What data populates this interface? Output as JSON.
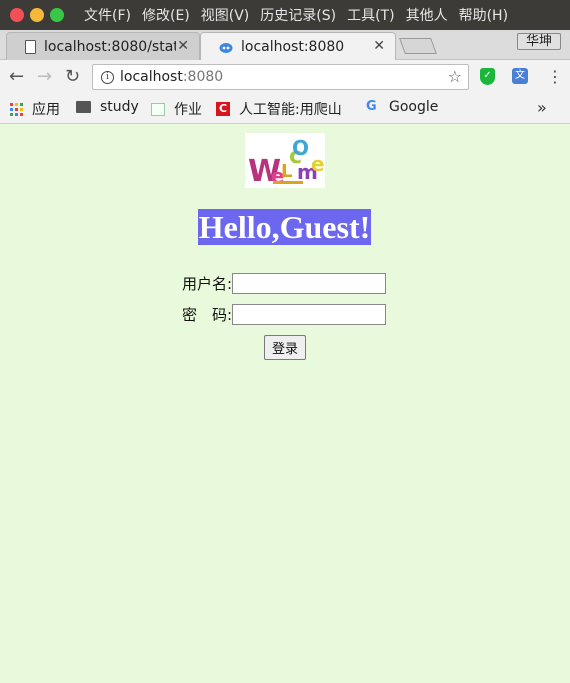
{
  "menubar": {
    "items": [
      "文件(F)",
      "修改(E)",
      "视图(V)",
      "历史记录(S)",
      "工具(T)",
      "其他人",
      "帮助(H)"
    ]
  },
  "tabs": [
    {
      "title": "localhost:8080/stat",
      "active": false
    },
    {
      "title": "localhost:8080",
      "active": true
    }
  ],
  "profile_name": "华坤",
  "address_bar": {
    "host": "localhost",
    "port": ":8080"
  },
  "bookmarks": {
    "apps": "应用",
    "study": "study",
    "zuoye": "作业",
    "ai": "人工智能:用爬山",
    "google": "Google",
    "more": "»"
  },
  "page": {
    "logo_text": "Welcome",
    "greeting": "Hello,Guest!",
    "username_label": "用户名:",
    "username_value": "",
    "password_label": "密　码:",
    "password_value": "",
    "login_button": "登录"
  },
  "colors": {
    "page_background": "#e9f9dc",
    "greeting_background": "#6c67ee"
  }
}
